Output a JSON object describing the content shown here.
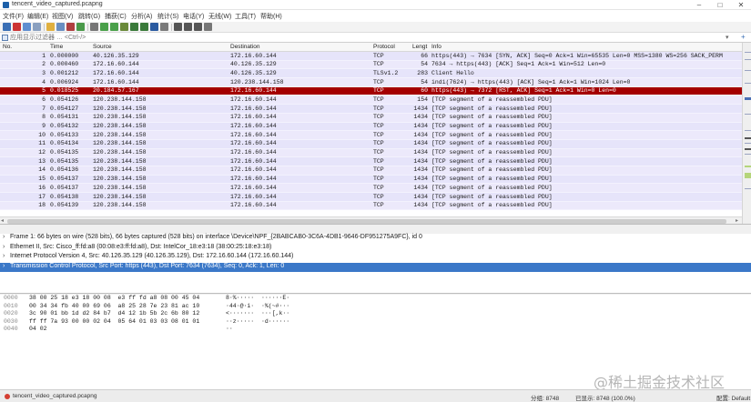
{
  "window": {
    "title": "tencent_video_captured.pcapng"
  },
  "menu": [
    "文件(F)",
    "编辑(E)",
    "视图(V)",
    "跳转(G)",
    "捕获(C)",
    "分析(A)",
    "统计(S)",
    "电话(Y)",
    "无线(W)",
    "工具(T)",
    "帮助(H)"
  ],
  "filter": {
    "placeholder": "应用显示过滤器 … <Ctrl-/>",
    "plus": "+"
  },
  "columns": {
    "no": "No.",
    "time": "Time",
    "source": "Source",
    "destination": "Destination",
    "protocol": "Protocol",
    "length": "Lengt",
    "info": "Info"
  },
  "packets": [
    {
      "no": "1",
      "time": "0.000000",
      "src": "40.126.35.129",
      "dst": "172.16.60.144",
      "proto": "TCP",
      "len": "66",
      "info": "https(443) → 7634 [SYN, ACK] Seq=0 Ack=1 Win=65535 Len=0 MSS=1380 WS=256 SACK_PERM"
    },
    {
      "no": "2",
      "time": "0.000460",
      "src": "172.16.60.144",
      "dst": "40.126.35.129",
      "proto": "TCP",
      "len": "54",
      "info": "7634 → https(443) [ACK] Seq=1 Ack=1 Win=512 Len=0"
    },
    {
      "no": "3",
      "time": "0.001212",
      "src": "172.16.60.144",
      "dst": "40.126.35.129",
      "proto": "TLSv1.2",
      "len": "283",
      "info": "Client Hello"
    },
    {
      "no": "4",
      "time": "0.006924",
      "src": "172.16.60.144",
      "dst": "120.238.144.158",
      "proto": "TCP",
      "len": "54",
      "info": "indi(7624) → https(443) [ACK] Seq=1 Ack=1 Win=1024 Len=0"
    },
    {
      "no": "5",
      "time": "0.018525",
      "src": "20.184.57.167",
      "dst": "172.16.60.144",
      "proto": "TCP",
      "len": "60",
      "info": "https(443) → 7372 [RST, ACK] Seq=1 Ack=1 Win=0 Len=0"
    },
    {
      "no": "6",
      "time": "0.054126",
      "src": "120.238.144.158",
      "dst": "172.16.60.144",
      "proto": "TCP",
      "len": "154",
      "info": "[TCP segment of a reassembled PDU]"
    },
    {
      "no": "7",
      "time": "0.054127",
      "src": "120.238.144.158",
      "dst": "172.16.60.144",
      "proto": "TCP",
      "len": "1434",
      "info": "[TCP segment of a reassembled PDU]"
    },
    {
      "no": "8",
      "time": "0.054131",
      "src": "120.238.144.158",
      "dst": "172.16.60.144",
      "proto": "TCP",
      "len": "1434",
      "info": "[TCP segment of a reassembled PDU]"
    },
    {
      "no": "9",
      "time": "0.054132",
      "src": "120.238.144.158",
      "dst": "172.16.60.144",
      "proto": "TCP",
      "len": "1434",
      "info": "[TCP segment of a reassembled PDU]"
    },
    {
      "no": "10",
      "time": "0.054133",
      "src": "120.238.144.158",
      "dst": "172.16.60.144",
      "proto": "TCP",
      "len": "1434",
      "info": "[TCP segment of a reassembled PDU]"
    },
    {
      "no": "11",
      "time": "0.054134",
      "src": "120.238.144.158",
      "dst": "172.16.60.144",
      "proto": "TCP",
      "len": "1434",
      "info": "[TCP segment of a reassembled PDU]"
    },
    {
      "no": "12",
      "time": "0.054135",
      "src": "120.238.144.158",
      "dst": "172.16.60.144",
      "proto": "TCP",
      "len": "1434",
      "info": "[TCP segment of a reassembled PDU]"
    },
    {
      "no": "13",
      "time": "0.054135",
      "src": "120.238.144.158",
      "dst": "172.16.60.144",
      "proto": "TCP",
      "len": "1434",
      "info": "[TCP segment of a reassembled PDU]"
    },
    {
      "no": "14",
      "time": "0.054136",
      "src": "120.238.144.158",
      "dst": "172.16.60.144",
      "proto": "TCP",
      "len": "1434",
      "info": "[TCP segment of a reassembled PDU]"
    },
    {
      "no": "15",
      "time": "0.054137",
      "src": "120.238.144.158",
      "dst": "172.16.60.144",
      "proto": "TCP",
      "len": "1434",
      "info": "[TCP segment of a reassembled PDU]"
    },
    {
      "no": "16",
      "time": "0.054137",
      "src": "120.238.144.158",
      "dst": "172.16.60.144",
      "proto": "TCP",
      "len": "1434",
      "info": "[TCP segment of a reassembled PDU]"
    },
    {
      "no": "17",
      "time": "0.054138",
      "src": "120.238.144.158",
      "dst": "172.16.60.144",
      "proto": "TCP",
      "len": "1434",
      "info": "[TCP segment of a reassembled PDU]"
    },
    {
      "no": "18",
      "time": "0.054139",
      "src": "120.238.144.158",
      "dst": "172.16.60.144",
      "proto": "TCP",
      "len": "1434",
      "info": "[TCP segment of a reassembled PDU]"
    }
  ],
  "selected_packet_index": 4,
  "colors": {
    "row_bg": "#e6e4fa",
    "selected_row": "#a40000",
    "selected_detail": "#3b78c8"
  },
  "details": [
    "Frame 1: 66 bytes on wire (528 bits), 66 bytes captured (528 bits) on interface \\Device\\NPF_{2BABCAB0-3C6A-4DB1-9646-DF951275A9FC}, id 0",
    "Ethernet II, Src: Cisco_ff:fd:a8 (00:08:e3:ff:fd:a8), Dst: IntelCor_18:e3:18 (38:00:25:18:e3:18)",
    "Internet Protocol Version 4, Src: 40.126.35.129 (40.126.35.129), Dst: 172.16.60.144 (172.16.60.144)",
    "Transmission Control Protocol, Src Port: https (443), Dst Port: 7634 (7634), Seq: 0, Ack: 1, Len: 0"
  ],
  "selected_detail_index": 3,
  "bytes": [
    {
      "off": "0000",
      "hex": "38 00 25 18 e3 18 00 08  e3 ff fd a8 08 00 45 04",
      "ascii": "8·%·····  ······E·"
    },
    {
      "off": "0010",
      "hex": "00 34 34 fb 40 00 69 06  a8 25 28 7e 23 81 ac 10",
      "ascii": "·44·@·i·  ·%(~#···"
    },
    {
      "off": "0020",
      "hex": "3c 90 01 bb 1d d2 84 b7  d4 12 1b 5b 2c 6b 80 12",
      "ascii": "<·······  ···[,k··"
    },
    {
      "off": "0030",
      "hex": "ff ff 7a 93 00 00 02 04  05 64 01 03 03 08 01 01",
      "ascii": "··z·····  ·d······"
    },
    {
      "off": "0040",
      "hex": "04 02",
      "ascii": "··"
    }
  ],
  "statusbar": {
    "file": "tencent_video_captured.pcapng",
    "packets": "分组: 8748",
    "displayed": "已显示: 8748 (100.0%)",
    "profile": "配置: Default"
  },
  "watermark": "@稀土掘金技术社区"
}
